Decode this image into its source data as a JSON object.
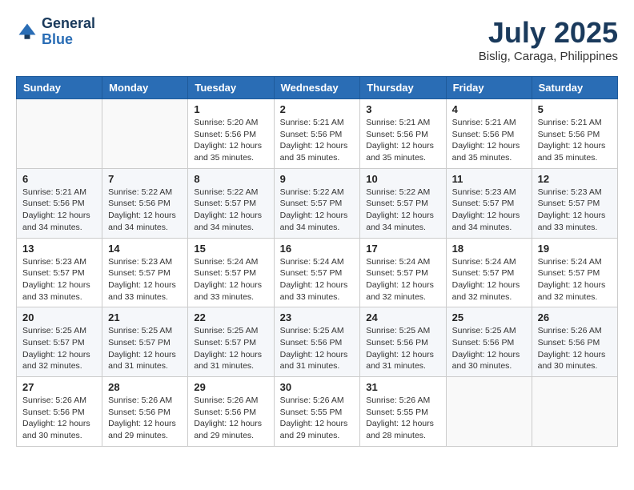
{
  "header": {
    "logo_line1": "General",
    "logo_line2": "Blue",
    "month_year": "July 2025",
    "location": "Bislig, Caraga, Philippines"
  },
  "weekdays": [
    "Sunday",
    "Monday",
    "Tuesday",
    "Wednesday",
    "Thursday",
    "Friday",
    "Saturday"
  ],
  "weeks": [
    [
      {
        "day": "",
        "sunrise": "",
        "sunset": "",
        "daylight": ""
      },
      {
        "day": "",
        "sunrise": "",
        "sunset": "",
        "daylight": ""
      },
      {
        "day": "1",
        "sunrise": "Sunrise: 5:20 AM",
        "sunset": "Sunset: 5:56 PM",
        "daylight": "Daylight: 12 hours and 35 minutes."
      },
      {
        "day": "2",
        "sunrise": "Sunrise: 5:21 AM",
        "sunset": "Sunset: 5:56 PM",
        "daylight": "Daylight: 12 hours and 35 minutes."
      },
      {
        "day": "3",
        "sunrise": "Sunrise: 5:21 AM",
        "sunset": "Sunset: 5:56 PM",
        "daylight": "Daylight: 12 hours and 35 minutes."
      },
      {
        "day": "4",
        "sunrise": "Sunrise: 5:21 AM",
        "sunset": "Sunset: 5:56 PM",
        "daylight": "Daylight: 12 hours and 35 minutes."
      },
      {
        "day": "5",
        "sunrise": "Sunrise: 5:21 AM",
        "sunset": "Sunset: 5:56 PM",
        "daylight": "Daylight: 12 hours and 35 minutes."
      }
    ],
    [
      {
        "day": "6",
        "sunrise": "Sunrise: 5:21 AM",
        "sunset": "Sunset: 5:56 PM",
        "daylight": "Daylight: 12 hours and 34 minutes."
      },
      {
        "day": "7",
        "sunrise": "Sunrise: 5:22 AM",
        "sunset": "Sunset: 5:56 PM",
        "daylight": "Daylight: 12 hours and 34 minutes."
      },
      {
        "day": "8",
        "sunrise": "Sunrise: 5:22 AM",
        "sunset": "Sunset: 5:57 PM",
        "daylight": "Daylight: 12 hours and 34 minutes."
      },
      {
        "day": "9",
        "sunrise": "Sunrise: 5:22 AM",
        "sunset": "Sunset: 5:57 PM",
        "daylight": "Daylight: 12 hours and 34 minutes."
      },
      {
        "day": "10",
        "sunrise": "Sunrise: 5:22 AM",
        "sunset": "Sunset: 5:57 PM",
        "daylight": "Daylight: 12 hours and 34 minutes."
      },
      {
        "day": "11",
        "sunrise": "Sunrise: 5:23 AM",
        "sunset": "Sunset: 5:57 PM",
        "daylight": "Daylight: 12 hours and 34 minutes."
      },
      {
        "day": "12",
        "sunrise": "Sunrise: 5:23 AM",
        "sunset": "Sunset: 5:57 PM",
        "daylight": "Daylight: 12 hours and 33 minutes."
      }
    ],
    [
      {
        "day": "13",
        "sunrise": "Sunrise: 5:23 AM",
        "sunset": "Sunset: 5:57 PM",
        "daylight": "Daylight: 12 hours and 33 minutes."
      },
      {
        "day": "14",
        "sunrise": "Sunrise: 5:23 AM",
        "sunset": "Sunset: 5:57 PM",
        "daylight": "Daylight: 12 hours and 33 minutes."
      },
      {
        "day": "15",
        "sunrise": "Sunrise: 5:24 AM",
        "sunset": "Sunset: 5:57 PM",
        "daylight": "Daylight: 12 hours and 33 minutes."
      },
      {
        "day": "16",
        "sunrise": "Sunrise: 5:24 AM",
        "sunset": "Sunset: 5:57 PM",
        "daylight": "Daylight: 12 hours and 33 minutes."
      },
      {
        "day": "17",
        "sunrise": "Sunrise: 5:24 AM",
        "sunset": "Sunset: 5:57 PM",
        "daylight": "Daylight: 12 hours and 32 minutes."
      },
      {
        "day": "18",
        "sunrise": "Sunrise: 5:24 AM",
        "sunset": "Sunset: 5:57 PM",
        "daylight": "Daylight: 12 hours and 32 minutes."
      },
      {
        "day": "19",
        "sunrise": "Sunrise: 5:24 AM",
        "sunset": "Sunset: 5:57 PM",
        "daylight": "Daylight: 12 hours and 32 minutes."
      }
    ],
    [
      {
        "day": "20",
        "sunrise": "Sunrise: 5:25 AM",
        "sunset": "Sunset: 5:57 PM",
        "daylight": "Daylight: 12 hours and 32 minutes."
      },
      {
        "day": "21",
        "sunrise": "Sunrise: 5:25 AM",
        "sunset": "Sunset: 5:57 PM",
        "daylight": "Daylight: 12 hours and 31 minutes."
      },
      {
        "day": "22",
        "sunrise": "Sunrise: 5:25 AM",
        "sunset": "Sunset: 5:57 PM",
        "daylight": "Daylight: 12 hours and 31 minutes."
      },
      {
        "day": "23",
        "sunrise": "Sunrise: 5:25 AM",
        "sunset": "Sunset: 5:56 PM",
        "daylight": "Daylight: 12 hours and 31 minutes."
      },
      {
        "day": "24",
        "sunrise": "Sunrise: 5:25 AM",
        "sunset": "Sunset: 5:56 PM",
        "daylight": "Daylight: 12 hours and 31 minutes."
      },
      {
        "day": "25",
        "sunrise": "Sunrise: 5:25 AM",
        "sunset": "Sunset: 5:56 PM",
        "daylight": "Daylight: 12 hours and 30 minutes."
      },
      {
        "day": "26",
        "sunrise": "Sunrise: 5:26 AM",
        "sunset": "Sunset: 5:56 PM",
        "daylight": "Daylight: 12 hours and 30 minutes."
      }
    ],
    [
      {
        "day": "27",
        "sunrise": "Sunrise: 5:26 AM",
        "sunset": "Sunset: 5:56 PM",
        "daylight": "Daylight: 12 hours and 30 minutes."
      },
      {
        "day": "28",
        "sunrise": "Sunrise: 5:26 AM",
        "sunset": "Sunset: 5:56 PM",
        "daylight": "Daylight: 12 hours and 29 minutes."
      },
      {
        "day": "29",
        "sunrise": "Sunrise: 5:26 AM",
        "sunset": "Sunset: 5:56 PM",
        "daylight": "Daylight: 12 hours and 29 minutes."
      },
      {
        "day": "30",
        "sunrise": "Sunrise: 5:26 AM",
        "sunset": "Sunset: 5:55 PM",
        "daylight": "Daylight: 12 hours and 29 minutes."
      },
      {
        "day": "31",
        "sunrise": "Sunrise: 5:26 AM",
        "sunset": "Sunset: 5:55 PM",
        "daylight": "Daylight: 12 hours and 28 minutes."
      },
      {
        "day": "",
        "sunrise": "",
        "sunset": "",
        "daylight": ""
      },
      {
        "day": "",
        "sunrise": "",
        "sunset": "",
        "daylight": ""
      }
    ]
  ]
}
